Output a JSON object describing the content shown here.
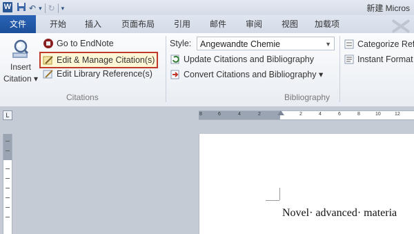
{
  "titlebar": {
    "app_icon_letter": "W",
    "qat": {
      "save_icon": "save-icon",
      "undo_icon": "undo-icon",
      "undo_glyph": "↶",
      "undo_dropdown": "▾",
      "redo_icon": "redo-icon",
      "redo_glyph": "↻",
      "customize_glyph": "▾"
    },
    "window_title": "新建 Micros"
  },
  "tabs": {
    "file": "文件",
    "items": [
      "开始",
      "插入",
      "页面布局",
      "引用",
      "邮件",
      "审阅",
      "视图",
      "加载项"
    ]
  },
  "citations_group": {
    "label": "Citations",
    "insert_citation_line1": "Insert",
    "insert_citation_line2": "Citation ▾",
    "go_to_endnote": "Go to EndNote",
    "edit_manage": "Edit & Manage Citation(s)",
    "edit_library": "Edit Library Reference(s)"
  },
  "bibliography_group": {
    "label": "Bibliography",
    "style_label": "Style:",
    "style_value": "Angewandte Chemie",
    "update": "Update Citations and Bibliography",
    "convert": "Convert Citations and Bibliography ▾"
  },
  "extra_group": {
    "categorize": "Categorize Ref",
    "instant": "Instant Format"
  },
  "ruler": {
    "corner": "L",
    "ticks": [
      "8",
      "6",
      "4",
      "2",
      "2",
      "4",
      "6",
      "8",
      "10",
      "12"
    ]
  },
  "document": {
    "text": "Novel· advanced· materia"
  },
  "colors": {
    "file_tab": "#1c4f9c",
    "highlight_border": "#c0392b"
  }
}
